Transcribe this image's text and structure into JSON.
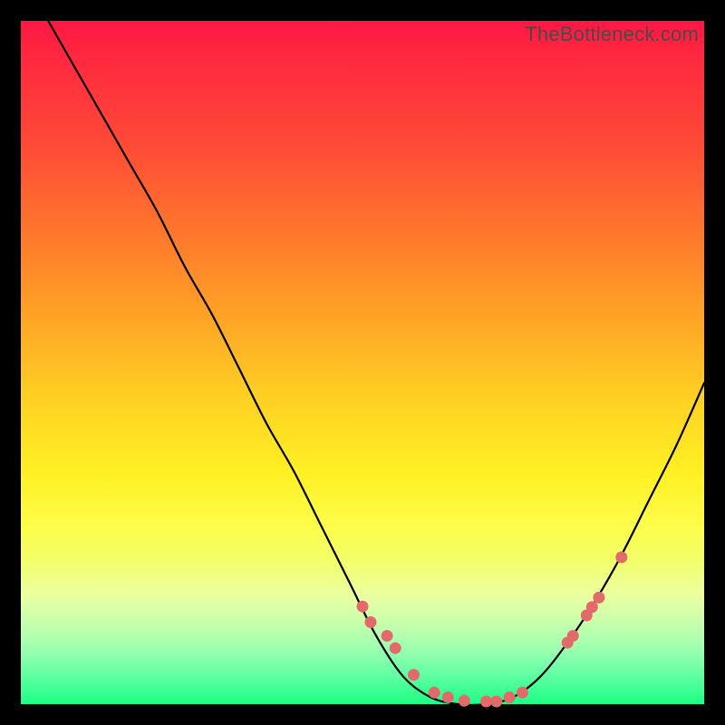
{
  "watermark": "TheBottleneck.com",
  "colors": {
    "background": "#000000",
    "curve": "#000000",
    "marker": "#e36a6a"
  },
  "chart_data": {
    "type": "line",
    "title": "",
    "xlabel": "",
    "ylabel": "",
    "xlim": [
      0,
      100
    ],
    "ylim": [
      0,
      100
    ],
    "series": [
      {
        "name": "curve",
        "x": [
          4,
          8,
          12,
          16,
          20,
          24,
          28,
          32,
          36,
          40,
          44,
          48,
          52,
          56,
          60,
          64,
          68,
          72,
          76,
          80,
          84,
          88,
          92,
          96,
          100
        ],
        "y": [
          100,
          93,
          86,
          79,
          72,
          64,
          57,
          49,
          41,
          34,
          26,
          18,
          10,
          4,
          1,
          0,
          0,
          1,
          4,
          9,
          15,
          22,
          30,
          38,
          47
        ]
      }
    ],
    "markers": {
      "name": "points",
      "x": [
        50.0,
        51.2,
        53.6,
        54.8,
        57.5,
        60.5,
        62.5,
        64.9,
        68.1,
        69.6,
        71.5,
        73.4,
        80.0,
        80.8,
        82.8,
        83.6,
        84.6,
        87.9
      ],
      "y": [
        14.3,
        12.0,
        10.0,
        8.2,
        4.3,
        1.7,
        1.0,
        0.5,
        0.4,
        0.4,
        1.0,
        1.7,
        9.0,
        10.0,
        13.0,
        14.2,
        15.6,
        21.5
      ]
    }
  }
}
